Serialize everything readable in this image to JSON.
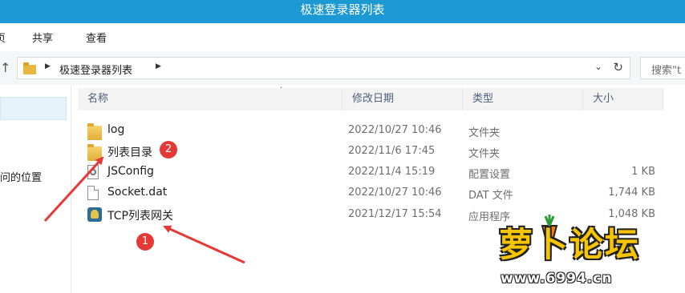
{
  "window": {
    "title": "极速登录器列表"
  },
  "ribbon": {
    "tabs": [
      "页",
      "共享",
      "查看"
    ]
  },
  "address": {
    "path_segment": "极速登录器列表",
    "search_placeholder": "搜索\"t"
  },
  "nav": {
    "item_label": "问的位置"
  },
  "columns": {
    "name": "名称",
    "modified": "修改日期",
    "type": "类型",
    "size": "大小"
  },
  "files": [
    {
      "name": "log",
      "modified": "2022/10/27 10:46",
      "type": "文件夹",
      "size": "",
      "icon": "folder-icon"
    },
    {
      "name": "列表目录",
      "modified": "2022/11/6 17:45",
      "type": "文件夹",
      "size": "",
      "icon": "folder-icon"
    },
    {
      "name": "JSConfig",
      "modified": "2022/11/4 15:19",
      "type": "配置设置",
      "size": "1 KB",
      "icon": "config-file-icon"
    },
    {
      "name": "Socket.dat",
      "modified": "2022/10/27 10:46",
      "type": "DAT 文件",
      "size": "1,744 KB",
      "icon": "file-icon"
    },
    {
      "name": "TCP列表网关",
      "modified": "2021/12/17 15:54",
      "type": "应用程序",
      "size": "1,048 KB",
      "icon": "app-icon"
    }
  ],
  "annotations": [
    {
      "label": "1",
      "color": "#e53935"
    },
    {
      "label": "2",
      "color": "#e53935"
    }
  ],
  "watermark": {
    "text": "萝卜论坛",
    "url": "www.6994.cn"
  },
  "colors": {
    "titlebar": "#1c99d2",
    "selection": "#e5f3fb",
    "annotation": "#e53935",
    "watermark": "#f6c400"
  }
}
